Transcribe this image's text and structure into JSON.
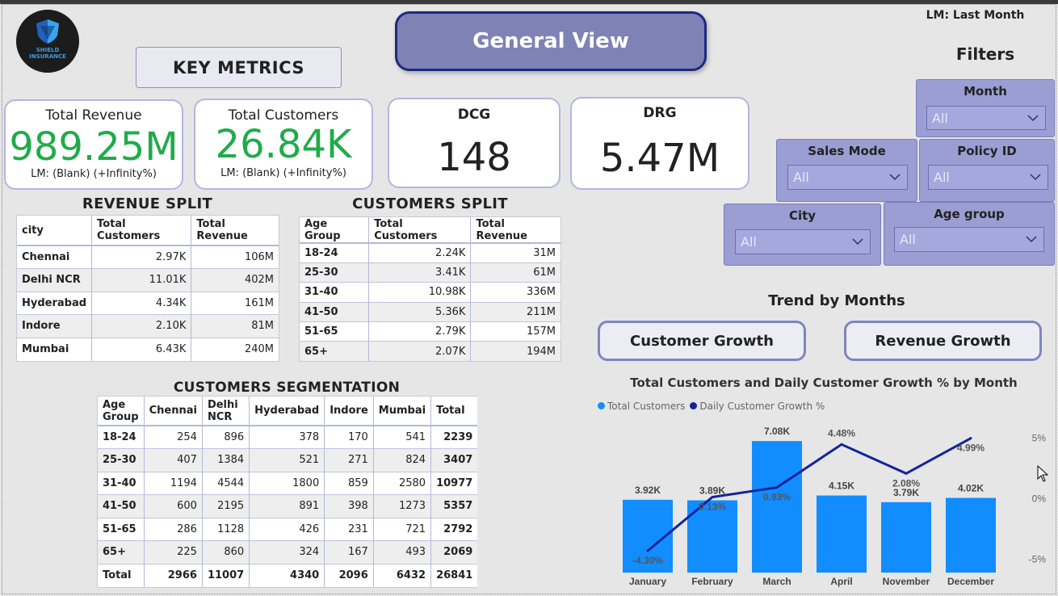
{
  "logo": {
    "line1": "SHIELD",
    "line2": "INSURANCE"
  },
  "header": {
    "key_metrics": "KEY METRICS",
    "view_title": "General View",
    "lm_note": "LM: Last Month",
    "filters_title": "Filters"
  },
  "kpis": {
    "total_revenue": {
      "label": "Total Revenue",
      "value": "989.25M",
      "sub": "LM: (Blank) (+Infinity%)"
    },
    "total_customers": {
      "label": "Total Customers",
      "value": "26.84K",
      "sub": "LM: (Blank) (+Infinity%)"
    },
    "dcg": {
      "label": "DCG",
      "value": "148"
    },
    "drg": {
      "label": "DRG",
      "value": "5.47M"
    }
  },
  "revenue_split": {
    "title": "REVENUE SPLIT",
    "headers": [
      "city",
      "Total Customers",
      "Total Revenue"
    ],
    "rows": [
      [
        "Chennai",
        "2.97K",
        "106M"
      ],
      [
        "Delhi NCR",
        "11.01K",
        "402M"
      ],
      [
        "Hyderabad",
        "4.34K",
        "161M"
      ],
      [
        "Indore",
        "2.10K",
        "81M"
      ],
      [
        "Mumbai",
        "6.43K",
        "240M"
      ]
    ]
  },
  "customers_split": {
    "title": "CUSTOMERS SPLIT",
    "headers": [
      "Age Group",
      "Total Customers",
      "Total Revenue"
    ],
    "rows": [
      [
        "18-24",
        "2.24K",
        "31M"
      ],
      [
        "25-30",
        "3.41K",
        "61M"
      ],
      [
        "31-40",
        "10.98K",
        "336M"
      ],
      [
        "41-50",
        "5.36K",
        "211M"
      ],
      [
        "51-65",
        "2.79K",
        "157M"
      ],
      [
        "65+",
        "2.07K",
        "194M"
      ]
    ]
  },
  "segmentation": {
    "title": "CUSTOMERS SEGMENTATION",
    "headers": [
      "Age Group",
      "Chennai",
      "Delhi NCR",
      "Hyderabad",
      "Indore",
      "Mumbai",
      "Total"
    ],
    "rows": [
      [
        "18-24",
        "254",
        "896",
        "378",
        "170",
        "541",
        "2239"
      ],
      [
        "25-30",
        "407",
        "1384",
        "521",
        "271",
        "824",
        "3407"
      ],
      [
        "31-40",
        "1194",
        "4544",
        "1800",
        "859",
        "2580",
        "10977"
      ],
      [
        "41-50",
        "600",
        "2195",
        "891",
        "398",
        "1273",
        "5357"
      ],
      [
        "51-65",
        "286",
        "1128",
        "426",
        "231",
        "721",
        "2792"
      ],
      [
        "65+",
        "225",
        "860",
        "324",
        "167",
        "493",
        "2069"
      ],
      [
        "Total",
        "2966",
        "11007",
        "4340",
        "2096",
        "6432",
        "26841"
      ]
    ]
  },
  "filters": {
    "month": {
      "label": "Month",
      "value": "All"
    },
    "sales_mode": {
      "label": "Sales Mode",
      "value": "All"
    },
    "policy_id": {
      "label": "Policy ID",
      "value": "All"
    },
    "city": {
      "label": "City",
      "value": "All"
    },
    "age_group": {
      "label": "Age group",
      "value": "All"
    }
  },
  "trend": {
    "title": "Trend by Months",
    "customer_growth": "Customer Growth",
    "revenue_growth": "Revenue Growth"
  },
  "colors": {
    "bar": "#118dff",
    "line": "#12239e",
    "panel": "#9a9ed3"
  },
  "chart_data": {
    "type": "bar",
    "title": "Total Customers and Daily Customer Growth % by Month",
    "categories": [
      "January",
      "February",
      "March",
      "April",
      "November",
      "December"
    ],
    "series": [
      {
        "name": "Total Customers",
        "type": "bar",
        "values": [
          3920,
          3890,
          7080,
          4150,
          3790,
          4020
        ],
        "labels": [
          "3.92K",
          "3.89K",
          "7.08K",
          "4.15K",
          "3.79K",
          "4.02K"
        ]
      },
      {
        "name": "Daily Customer Growth %",
        "type": "line",
        "values": [
          -4.3,
          0.13,
          0.93,
          4.48,
          2.08,
          4.99
        ],
        "labels": [
          "-4.30%",
          "0.13%",
          "0.93%",
          "4.48%",
          "2.08%",
          "4.99%"
        ]
      }
    ],
    "y_right_ticks": [
      "5%",
      "0%",
      "-5%"
    ],
    "y_right_range": [
      -5,
      5
    ],
    "legend_position": "top-left",
    "grid": false
  }
}
